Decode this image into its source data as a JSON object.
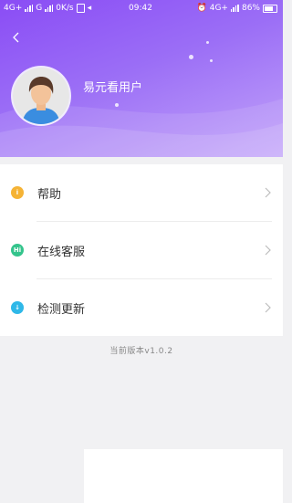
{
  "status_bar": {
    "left_signal1": "4G+",
    "left_signal2": "G",
    "net_speed": "0K/s",
    "time": "09:42",
    "right_network": "4G+",
    "battery_percent": "86%"
  },
  "profile": {
    "username": "易元看用户"
  },
  "menu": {
    "items": [
      {
        "label": "帮助",
        "icon": "info-icon",
        "icon_text": "i",
        "color": "#f5b335"
      },
      {
        "label": "在线客服",
        "icon": "chat-icon",
        "icon_text": "Hi",
        "color": "#34c48c"
      },
      {
        "label": "检测更新",
        "icon": "download-icon",
        "icon_text": "↓",
        "color": "#2fb8e8"
      }
    ]
  },
  "footer": {
    "version": "当前版本v1.0.2"
  },
  "colors": {
    "header_start": "#8a4cf5",
    "header_end": "#c2a4fa",
    "background": "#f1f1f3"
  }
}
